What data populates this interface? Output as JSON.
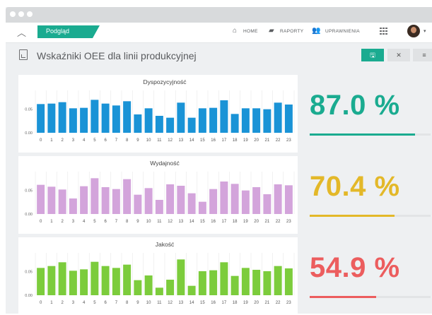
{
  "nav": {
    "active_tab": "Podgląd",
    "links": [
      {
        "label": "HOME",
        "icon": "home-icon"
      },
      {
        "label": "RAPORTY",
        "icon": "book-icon"
      },
      {
        "label": "UPRAWNIENIA",
        "icon": "users-icon"
      }
    ]
  },
  "page": {
    "title": "Wskaźniki OEE dla linii produkcyjnej",
    "buttons": [
      {
        "label": "🖫",
        "icon": "save-icon"
      },
      {
        "label": "✕",
        "icon": "close-icon"
      },
      {
        "label": "≡",
        "icon": "menu-icon"
      }
    ]
  },
  "colors": {
    "accent": "#1aab90",
    "blue": "#1a93d6",
    "violet": "#d3a4db",
    "green": "#7ccc3c",
    "yellow": "#e3b829",
    "red": "#ec5d5e"
  },
  "kpis": [
    {
      "value": "87.0 %",
      "fraction": 0.87,
      "color": "#1aab90"
    },
    {
      "value": "70.4 %",
      "fraction": 0.704,
      "color": "#e3b829"
    },
    {
      "value": "54.9 %",
      "fraction": 0.549,
      "color": "#ec5d5e"
    }
  ],
  "chart_data": [
    {
      "type": "bar",
      "title": "Dyspozycyjność",
      "color": "#1a93d6",
      "categories": [
        "0",
        "1",
        "2",
        "3",
        "4",
        "5",
        "6",
        "7",
        "8",
        "9",
        "10",
        "11",
        "12",
        "13",
        "14",
        "15",
        "16",
        "17",
        "18",
        "19",
        "20",
        "21",
        "22",
        "23"
      ],
      "yticks": [
        "0.00",
        "0.05"
      ],
      "ylim": [
        0,
        0.09
      ],
      "values": [
        0.061,
        0.062,
        0.065,
        0.052,
        0.053,
        0.07,
        0.062,
        0.058,
        0.067,
        0.039,
        0.052,
        0.036,
        0.032,
        0.064,
        0.032,
        0.052,
        0.053,
        0.069,
        0.04,
        0.052,
        0.052,
        0.05,
        0.064,
        0.06
      ],
      "grid": "vertical"
    },
    {
      "type": "bar",
      "title": "Wydajność",
      "color": "#d3a4db",
      "categories": [
        "0",
        "1",
        "2",
        "3",
        "4",
        "5",
        "6",
        "7",
        "8",
        "9",
        "10",
        "11",
        "12",
        "13",
        "14",
        "15",
        "16",
        "17",
        "18",
        "19",
        "20",
        "21",
        "22",
        "23"
      ],
      "yticks": [
        "0.00",
        "0.05"
      ],
      "ylim": [
        0,
        0.09
      ],
      "values": [
        0.062,
        0.058,
        0.052,
        0.033,
        0.059,
        0.076,
        0.057,
        0.053,
        0.074,
        0.041,
        0.055,
        0.03,
        0.063,
        0.06,
        0.044,
        0.026,
        0.053,
        0.069,
        0.064,
        0.05,
        0.057,
        0.042,
        0.063,
        0.061
      ],
      "grid": "vertical"
    },
    {
      "type": "bar",
      "title": "Jakość",
      "color": "#7ccc3c",
      "categories": [
        "0",
        "1",
        "2",
        "3",
        "4",
        "5",
        "6",
        "7",
        "8",
        "9",
        "10",
        "11",
        "12",
        "13",
        "14",
        "15",
        "16",
        "17",
        "18",
        "19",
        "20",
        "21",
        "22",
        "23"
      ],
      "yticks": [
        "0.00",
        "0.05"
      ],
      "ylim": [
        0,
        0.09
      ],
      "values": [
        0.058,
        0.062,
        0.07,
        0.052,
        0.055,
        0.071,
        0.062,
        0.058,
        0.065,
        0.032,
        0.042,
        0.016,
        0.033,
        0.076,
        0.02,
        0.051,
        0.053,
        0.07,
        0.041,
        0.058,
        0.054,
        0.051,
        0.062,
        0.057
      ],
      "grid": "vertical"
    }
  ]
}
